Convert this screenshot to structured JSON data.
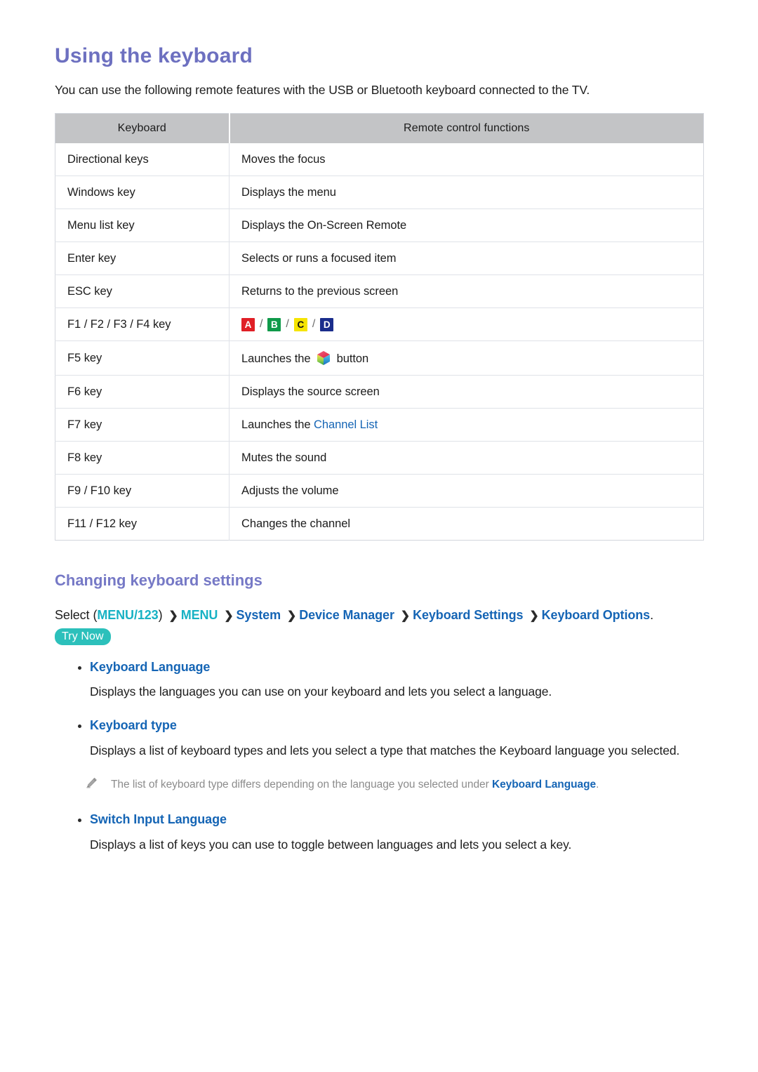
{
  "page": {
    "title": "Using the keyboard",
    "intro": "You can use the following remote features with the USB or Bluetooth keyboard connected to the TV."
  },
  "colors": {
    "heading_purple": "#6d70c0",
    "link_blue": "#1565b5",
    "cyan": "#17b2c4",
    "try_now_teal": "#2cc0bb",
    "table_header_gray": "#c3c4c6",
    "note_gray": "#8c8c8c",
    "chip_a": "#e01f26",
    "chip_b": "#0f9a4a",
    "chip_c": "#f5e400",
    "chip_d": "#1a2d8c"
  },
  "table": {
    "headers": [
      "Keyboard",
      "Remote control functions"
    ],
    "rows": [
      {
        "key": "Directional keys",
        "function": "Moves the focus"
      },
      {
        "key": "Windows key",
        "function": "Displays the menu"
      },
      {
        "key": "Menu list key",
        "function": "Displays the On-Screen Remote"
      },
      {
        "key": "Enter key",
        "function": "Selects or runs a focused item"
      },
      {
        "key": "ESC key",
        "function": "Returns to the previous screen"
      },
      {
        "key": "F1 / F2 / F3 / F4 key",
        "function": "",
        "chips": [
          "A",
          "B",
          "C",
          "D"
        ],
        "separator": "/"
      },
      {
        "key": "F5 key",
        "function_before_icon": "Launches the",
        "icon": "smart-hub-icon",
        "function_after_icon": "button"
      },
      {
        "key": "F6 key",
        "function": "Displays the source screen"
      },
      {
        "key": "F7 key",
        "function_prefix": "Launches the",
        "function_link": "Channel List"
      },
      {
        "key": "F8 key",
        "function": "Mutes the sound"
      },
      {
        "key": "F9 / F10 key",
        "function": "Adjusts the volume"
      },
      {
        "key": "F11 / F12 key",
        "function": "Changes the channel"
      }
    ]
  },
  "settings_section": {
    "heading": "Changing keyboard settings",
    "path": {
      "lead": "Select",
      "open_paren": "(",
      "close_paren": ")",
      "tokens": [
        {
          "text": "MENU/123",
          "style": "cyan"
        },
        {
          "text": "MENU",
          "style": "cyan"
        },
        {
          "text": "System",
          "style": "blue"
        },
        {
          "text": "Device Manager",
          "style": "blue"
        },
        {
          "text": "Keyboard Settings",
          "style": "blue"
        },
        {
          "text": "Keyboard Options",
          "style": "blue"
        }
      ],
      "separator": "❯",
      "terminator": "."
    },
    "try_now": "Try Now",
    "items": [
      {
        "title": "Keyboard Language",
        "desc": "Displays the languages you can use on your keyboard and lets you select a language."
      },
      {
        "title": "Keyboard type",
        "desc": "Displays a list of keyboard types and lets you select a type that matches the Keyboard language you selected."
      },
      {
        "title": "Switch Input Language",
        "desc": "Displays a list of keys you can use to toggle between languages and lets you select a key."
      }
    ],
    "note": {
      "icon": "pencil-icon",
      "text_before": "The list of keyboard type differs depending on the language you selected under",
      "emphasis": "Keyboard Language",
      "text_after": "."
    }
  }
}
